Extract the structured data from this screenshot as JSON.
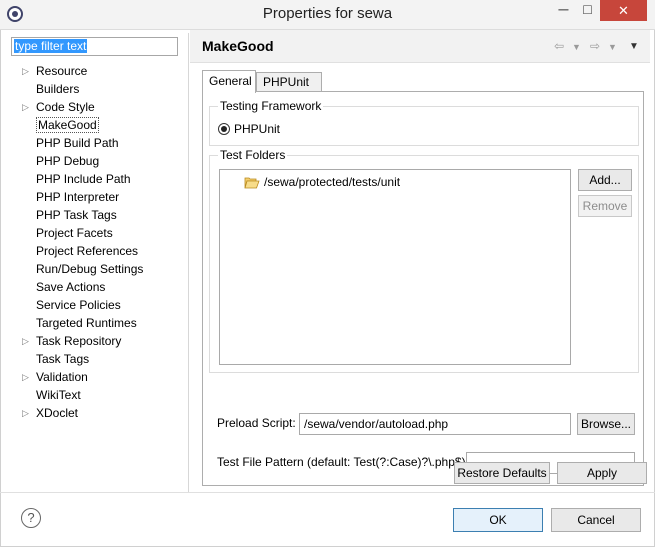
{
  "window": {
    "title": "Properties for sewa",
    "minimize_glyph": "─",
    "maximize_glyph": "□",
    "close_glyph": "✕"
  },
  "filter": {
    "value": "type filter text"
  },
  "tree": [
    {
      "label": "Resource",
      "expandable": true
    },
    {
      "label": "Builders",
      "expandable": false
    },
    {
      "label": "Code Style",
      "expandable": true
    },
    {
      "label": "MakeGood",
      "expandable": false,
      "selected": true
    },
    {
      "label": "PHP Build Path",
      "expandable": false
    },
    {
      "label": "PHP Debug",
      "expandable": false
    },
    {
      "label": "PHP Include Path",
      "expandable": false
    },
    {
      "label": "PHP Interpreter",
      "expandable": false
    },
    {
      "label": "PHP Task Tags",
      "expandable": false
    },
    {
      "label": "Project Facets",
      "expandable": false
    },
    {
      "label": "Project References",
      "expandable": false
    },
    {
      "label": "Run/Debug Settings",
      "expandable": false
    },
    {
      "label": "Save Actions",
      "expandable": false
    },
    {
      "label": "Service Policies",
      "expandable": false
    },
    {
      "label": "Targeted Runtimes",
      "expandable": false
    },
    {
      "label": "Task Repository",
      "expandable": true
    },
    {
      "label": "Task Tags",
      "expandable": false
    },
    {
      "label": "Validation",
      "expandable": true
    },
    {
      "label": "WikiText",
      "expandable": false
    },
    {
      "label": "XDoclet",
      "expandable": true
    }
  ],
  "page": {
    "title": "MakeGood",
    "tabs": [
      {
        "label": "General",
        "active": true
      },
      {
        "label": "PHPUnit",
        "active": false
      }
    ],
    "framework": {
      "title": "Testing Framework",
      "option": "PHPUnit",
      "selected": true
    },
    "folders": {
      "title": "Test Folders",
      "items": [
        "/sewa/protected/tests/unit"
      ],
      "add_label": "Add...",
      "remove_label": "Remove"
    },
    "preload": {
      "label": "Preload Script:",
      "value": "/sewa/vendor/autoload.php",
      "browse_label": "Browse..."
    },
    "pattern": {
      "label": "Test File Pattern (default: Test(?:Case)?\\.php$):",
      "value": ""
    },
    "restore_label": "Restore Defaults",
    "apply_label": "Apply"
  },
  "footer": {
    "help_glyph": "?",
    "ok_label": "OK",
    "cancel_label": "Cancel"
  },
  "colors": {
    "selection": "#3298fe",
    "close_button": "#c7463b",
    "folder": "#e2a733"
  }
}
